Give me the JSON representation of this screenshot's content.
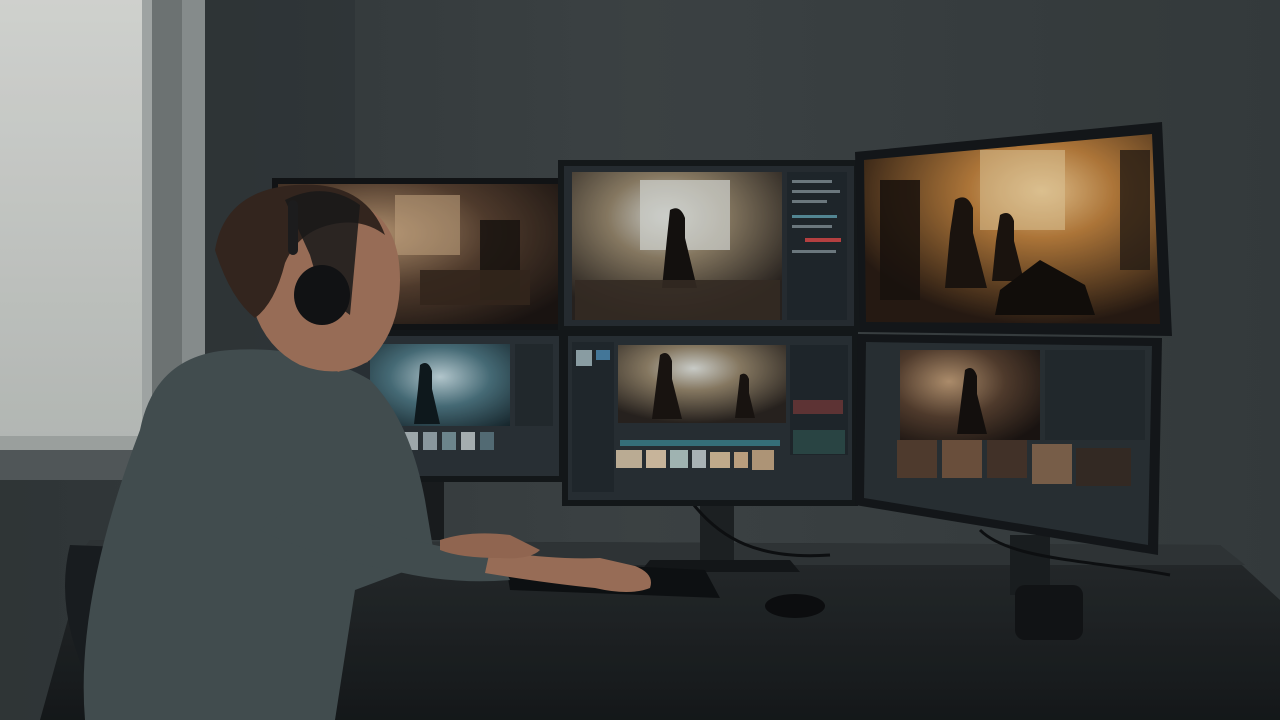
{
  "scene": {
    "description_colors": {
      "wall": "#3b4243",
      "wall_dark": "#262c2d",
      "window_light": "#e8ebe6",
      "desk": "#1f2324",
      "screen_ui": "#2b3338",
      "warm_light": "#f3c27a",
      "shirt": "#4a5759",
      "skin": "#b07d62",
      "hair": "#3a2a20"
    },
    "monitors": [
      {
        "id": "top-left",
        "content": "film-frame"
      },
      {
        "id": "top-center",
        "content": "editor-viewer"
      },
      {
        "id": "top-right",
        "content": "film-frame"
      },
      {
        "id": "bottom-left",
        "content": "editor-viewer"
      },
      {
        "id": "bottom-center",
        "content": "editor-timeline"
      },
      {
        "id": "bottom-right",
        "content": "editor-grid"
      }
    ]
  }
}
